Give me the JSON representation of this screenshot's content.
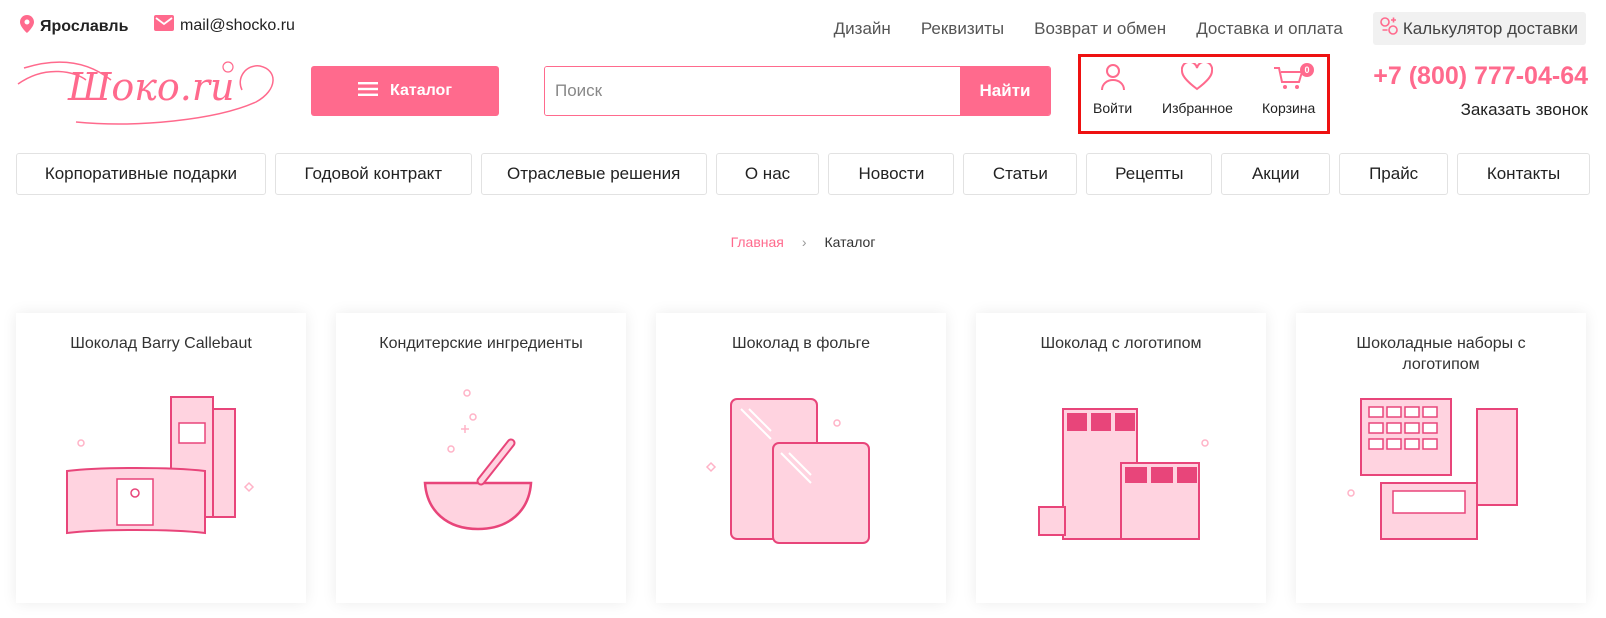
{
  "topbar": {
    "city": "Ярославль",
    "email": "mail@shocko.ru",
    "links": [
      "Дизайн",
      "Реквизиты",
      "Возврат и обмен",
      "Доставка и оплата"
    ],
    "calculator": "Калькулятор доставки"
  },
  "header": {
    "logo_text": "Шоко.ru",
    "catalog_label": "Каталог",
    "search_placeholder": "Поиск",
    "search_button": "Найти",
    "login_label": "Войти",
    "favorites_label": "Избранное",
    "cart_label": "Корзина",
    "cart_count": "0",
    "phone": "+7 (800) 777-04-64",
    "callback": "Заказать звонок"
  },
  "menu": [
    "Корпоративные подарки",
    "Годовой контракт",
    "Отраслевые решения",
    "О нас",
    "Новости",
    "Статьи",
    "Рецепты",
    "Акции",
    "Прайс",
    "Контакты"
  ],
  "breadcrumb": {
    "home": "Главная",
    "current": "Каталог"
  },
  "cards": [
    {
      "title": "Шоколад Barry Callebaut"
    },
    {
      "title": "Кондитерские ингредиенты"
    },
    {
      "title": "Шоколад в фольге"
    },
    {
      "title": "Шоколад с логотипом"
    },
    {
      "title": "Шоколадные наборы с логотипом"
    }
  ],
  "colors": {
    "accent": "#ff6a8d",
    "highlight_box": "#ee1111"
  }
}
